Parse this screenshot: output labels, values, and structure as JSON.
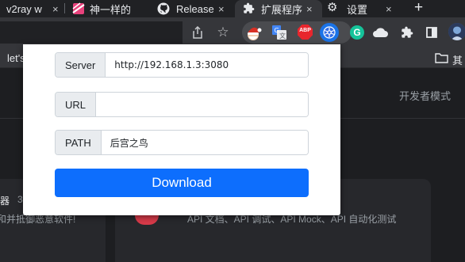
{
  "tabs": [
    {
      "label": "v2ray w",
      "close": "×"
    },
    {
      "label": "神一样的",
      "close": "×"
    },
    {
      "label": "Release",
      "close": "×"
    },
    {
      "label": "扩展程序",
      "close": "×"
    },
    {
      "label": "设置",
      "close": "×"
    }
  ],
  "newtab_label": "+",
  "extensions": {
    "abp_label": "ABP",
    "grammarly_label": "G"
  },
  "bookmarks": {
    "left_label": "let's",
    "folder_label": "其"
  },
  "background": {
    "dev_mode_label": "开发者模式",
    "left_card_title": "器",
    "left_card_count": "3",
    "left_card_desc": "和并抵御恶意软件!",
    "right_card_desc": "API 文档、API 调试、API Mock、API 自动化测试"
  },
  "popup": {
    "server": {
      "label": "Server",
      "value": "http://192.168.1.3:3080"
    },
    "url": {
      "label": "URL",
      "value": ""
    },
    "path": {
      "label": "PATH",
      "value": "后宫之鸟"
    },
    "download_label": "Download"
  },
  "colors": {
    "primary": "#0d6efd",
    "chrome_dark": "#202124",
    "toolbar": "#35363a"
  }
}
